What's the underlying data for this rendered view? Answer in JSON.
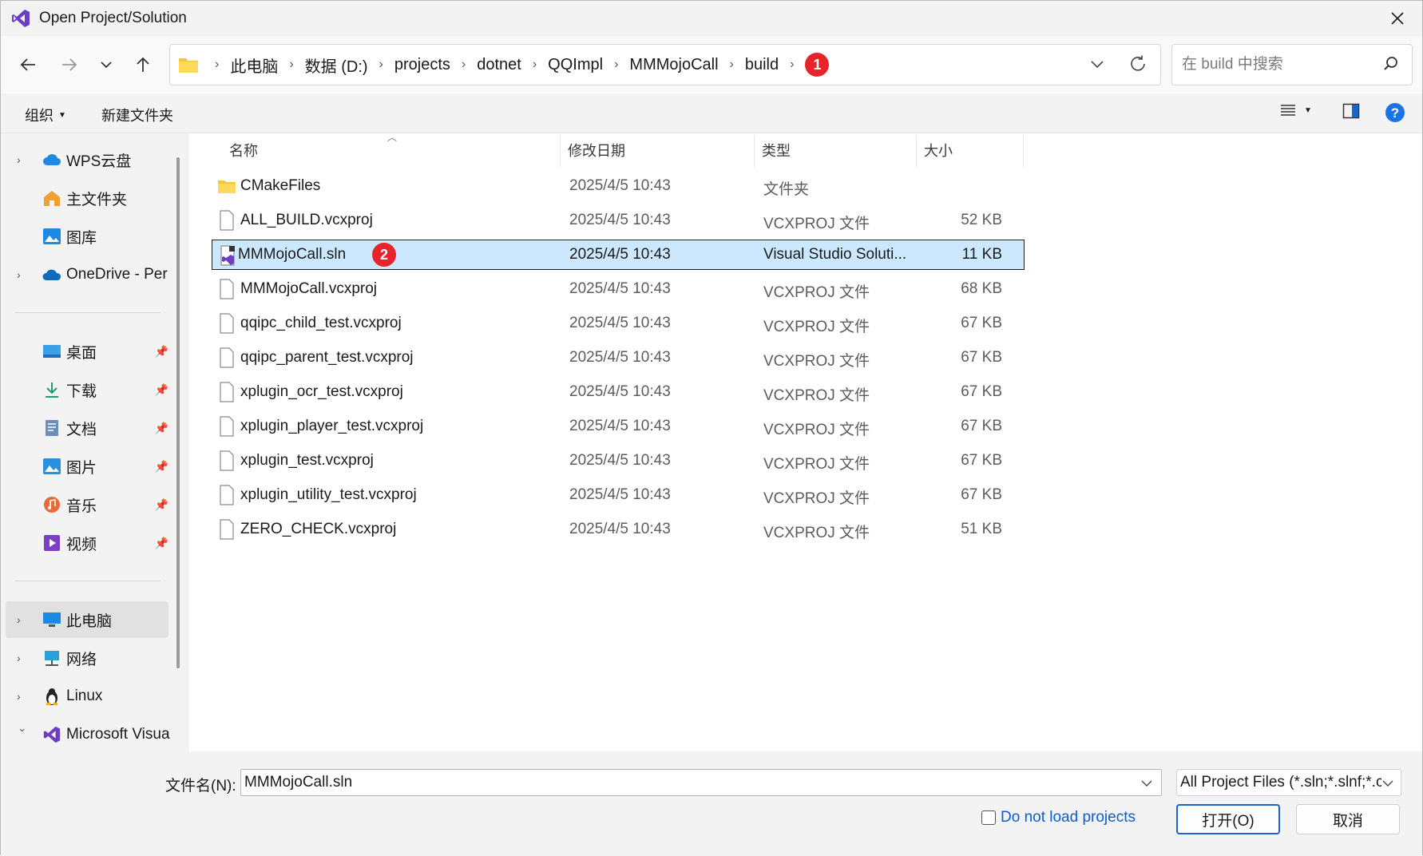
{
  "window": {
    "title": "Open Project/Solution"
  },
  "address": {
    "crumbs": [
      "此电脑",
      "数据 (D:)",
      "projects",
      "dotnet",
      "QQImpl",
      "MMMojoCall",
      "build"
    ],
    "badge": "1"
  },
  "search": {
    "placeholder": "在 build 中搜索"
  },
  "commands": {
    "organize": "组织",
    "new_folder": "新建文件夹"
  },
  "sidebar": {
    "items": [
      {
        "label": "WPS云盘",
        "icon": "cloud-icon"
      },
      {
        "label": "主文件夹",
        "icon": "home-icon"
      },
      {
        "label": "图库",
        "icon": "gallery-icon"
      },
      {
        "label": "OneDrive - Per",
        "icon": "onedrive-icon"
      },
      {
        "label": "桌面",
        "icon": "desktop-icon"
      },
      {
        "label": "下载",
        "icon": "download-icon"
      },
      {
        "label": "文档",
        "icon": "documents-icon"
      },
      {
        "label": "图片",
        "icon": "pictures-icon"
      },
      {
        "label": "音乐",
        "icon": "music-icon"
      },
      {
        "label": "视频",
        "icon": "videos-icon"
      },
      {
        "label": "此电脑",
        "icon": "this-pc-icon"
      },
      {
        "label": "网络",
        "icon": "network-icon"
      },
      {
        "label": "Linux",
        "icon": "linux-icon"
      },
      {
        "label": "Microsoft Visua",
        "icon": "visual-studio-icon"
      }
    ]
  },
  "columns": {
    "name": "名称",
    "modified": "修改日期",
    "type": "类型",
    "size": "大小"
  },
  "files": [
    {
      "name": "CMakeFiles",
      "modified": "2025/4/5 10:43",
      "type": "文件夹",
      "size": "",
      "icon": "folder-icon"
    },
    {
      "name": "ALL_BUILD.vcxproj",
      "modified": "2025/4/5 10:43",
      "type": "VCXPROJ 文件",
      "size": "52 KB",
      "icon": "file-icon"
    },
    {
      "name": "MMMojoCall.sln",
      "modified": "2025/4/5 10:43",
      "type": "Visual Studio Soluti...",
      "size": "11 KB",
      "icon": "solution-icon",
      "badge": "2"
    },
    {
      "name": "MMMojoCall.vcxproj",
      "modified": "2025/4/5 10:43",
      "type": "VCXPROJ 文件",
      "size": "68 KB",
      "icon": "file-icon"
    },
    {
      "name": "qqipc_child_test.vcxproj",
      "modified": "2025/4/5 10:43",
      "type": "VCXPROJ 文件",
      "size": "67 KB",
      "icon": "file-icon"
    },
    {
      "name": "qqipc_parent_test.vcxproj",
      "modified": "2025/4/5 10:43",
      "type": "VCXPROJ 文件",
      "size": "67 KB",
      "icon": "file-icon"
    },
    {
      "name": "xplugin_ocr_test.vcxproj",
      "modified": "2025/4/5 10:43",
      "type": "VCXPROJ 文件",
      "size": "67 KB",
      "icon": "file-icon"
    },
    {
      "name": "xplugin_player_test.vcxproj",
      "modified": "2025/4/5 10:43",
      "type": "VCXPROJ 文件",
      "size": "67 KB",
      "icon": "file-icon"
    },
    {
      "name": "xplugin_test.vcxproj",
      "modified": "2025/4/5 10:43",
      "type": "VCXPROJ 文件",
      "size": "67 KB",
      "icon": "file-icon"
    },
    {
      "name": "xplugin_utility_test.vcxproj",
      "modified": "2025/4/5 10:43",
      "type": "VCXPROJ 文件",
      "size": "67 KB",
      "icon": "file-icon"
    },
    {
      "name": "ZERO_CHECK.vcxproj",
      "modified": "2025/4/5 10:43",
      "type": "VCXPROJ 文件",
      "size": "51 KB",
      "icon": "file-icon"
    }
  ],
  "footer": {
    "filename_label": "文件名(N):",
    "filename_value": "MMMojoCall.sln",
    "filetype_value": "All Project Files (*.sln;*.slnf;*.c",
    "checkbox_label": "Do not load projects",
    "open_label": "打开(O)",
    "cancel_label": "取消"
  },
  "colors": {
    "selection": "#cce8ff",
    "accent": "#1a66c6",
    "badge": "#e8232a",
    "link": "#0b5cd6"
  }
}
